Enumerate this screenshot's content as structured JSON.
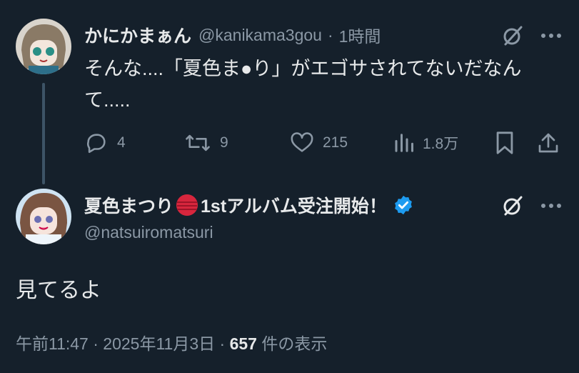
{
  "tweet1": {
    "name": "かにかまぁん",
    "handle": "@kanikama3gou",
    "separator": "·",
    "time": "1時間",
    "text_line1": "そんな....「夏色ま●り」がエゴサされてないだなん",
    "text_line2": "て.....",
    "actions": {
      "reply_count": "4",
      "retweet_count": "9",
      "like_count": "215",
      "view_count": "1.8万"
    }
  },
  "tweet2": {
    "name": "夏色まつり",
    "name_suffix": "1stアルバム受注開始！",
    "handle": "@natsuiromatsuri",
    "text": "見てるよ",
    "meta_time": "午前11:47 · 2025年11月3日 ·",
    "meta_views": "657",
    "meta_views_label": "件の表示"
  },
  "colors": {
    "background": "#15202b",
    "text": "#e7e9ea",
    "muted": "#8b98a5",
    "verified": "#1d9bf0",
    "flag_red": "#d7263d"
  },
  "icons": [
    "grok-icon",
    "more-icon",
    "reply-icon",
    "retweet-icon",
    "like-icon",
    "views-icon",
    "bookmark-icon",
    "share-icon",
    "verified-badge-icon",
    "red-orb-emoji"
  ]
}
